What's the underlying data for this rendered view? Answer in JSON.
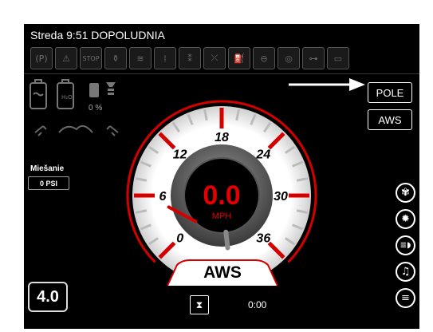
{
  "status": {
    "title": "Streda 9:51 DOPOLUDNIA"
  },
  "indicators": [
    {
      "name": "parking-brake-icon",
      "glyph": "(P)"
    },
    {
      "name": "warning-icon",
      "glyph": "⚠"
    },
    {
      "name": "stop-icon",
      "glyph": "STOP"
    },
    {
      "name": "filter-icon",
      "glyph": "⚱"
    },
    {
      "name": "coolant-temp-icon",
      "glyph": "≋"
    },
    {
      "name": "def-icon",
      "glyph": "⁞"
    },
    {
      "name": "engine-dpf-icon",
      "glyph": "⁑"
    },
    {
      "name": "dpf-disabled-icon",
      "glyph": "⤫"
    },
    {
      "name": "fuel-icon",
      "glyph": "⛽"
    },
    {
      "name": "engine-icon",
      "glyph": "⊖"
    },
    {
      "name": "oil-icon",
      "glyph": "◎"
    },
    {
      "name": "hydraulic-icon",
      "glyph": "⊶"
    },
    {
      "name": "tank-icon",
      "glyph": "▭"
    }
  ],
  "buttons": {
    "pole": "POLE",
    "aws_mode": "AWS"
  },
  "left": {
    "percent_label": "0 %",
    "mix_label": "Miešanie",
    "mix_value": "0 PSI",
    "gear_value": "4.0"
  },
  "speed": {
    "value": "0.0",
    "unit": "MPH",
    "mode": "AWS",
    "max": 36,
    "reading": 0,
    "ticks": [
      "0",
      "6",
      "12",
      "18",
      "24",
      "30",
      "36"
    ]
  },
  "timer": {
    "value": "0:00"
  },
  "controls": [
    {
      "name": "fan-icon",
      "glyph": "✾"
    },
    {
      "name": "work-light-icon",
      "glyph": "✹"
    },
    {
      "name": "headlight-icon",
      "glyph": "≣◗"
    },
    {
      "name": "music-icon",
      "glyph": "♫"
    },
    {
      "name": "menu-icon",
      "glyph": "≡"
    }
  ]
}
